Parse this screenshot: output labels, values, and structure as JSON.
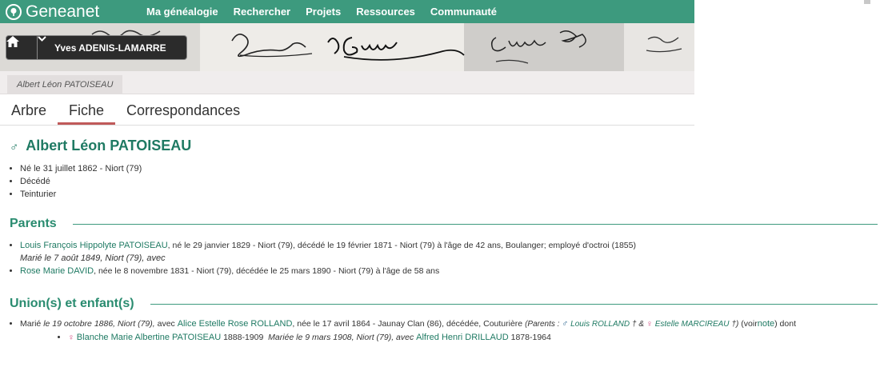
{
  "brand": {
    "name": "Geneanet"
  },
  "nav": {
    "items": [
      "Ma généalogie",
      "Rechercher",
      "Projets",
      "Ressources",
      "Communauté"
    ]
  },
  "tree_owner": "Yves ADENIS-LAMARRE",
  "breadcrumb": "Albert Léon PATOISEAU",
  "tabs": [
    "Arbre",
    "Fiche",
    "Correspondances"
  ],
  "active_tab": "Fiche",
  "person": {
    "name": "Albert Léon PATOISEAU",
    "facts": [
      "Né le 31 juillet 1862 - Niort (79)",
      "Décédé",
      "Teinturier"
    ]
  },
  "parents": {
    "title": "Parents",
    "father_link": "Louis François Hippolyte PATOISEAU",
    "father_details": ", né le 29 janvier 1829 - Niort (79), décédé le 19 février 1871 - Niort (79) à l'âge de 42 ans, Boulanger; employé d'octroi (1855)",
    "marriage": "Marié le 7 août 1849, Niort (79), avec",
    "mother_link": "Rose Marie DAVID",
    "mother_details": ", née le 8 novembre 1831 - Niort (79), décédée le 25 mars 1890 - Niort (79) à l'âge de 58 ans"
  },
  "unions": {
    "title": "Union(s) et enfant(s)",
    "married": "Marié",
    "marriage_date": "le 19 octobre 1886, Niort (79),",
    "with": "avec",
    "spouse_link": "Alice Estelle Rose ROLLAND",
    "spouse_details": ", née le 17 avril 1864 - Jaunay Clan (86), décédée, Couturière",
    "parents_label": "(Parents :",
    "spouse_father": "Louis ROLLAND",
    "dagger_amp": "† &",
    "spouse_mother": "Estelle MARCIREAU",
    "dagger_close": "†)",
    "voir": "(voir",
    "note_link": "note",
    "dont": ") dont",
    "child_link": "Blanche Marie Albertine PATOISEAU",
    "child_years": "1888-1909",
    "child_marriage": "Mariée le 9 mars 1908, Niort (79), avec",
    "child_spouse_link": "Alfred Henri DRILLAUD",
    "child_spouse_years": "1878-1964"
  },
  "colors": {
    "brand_green": "#3d9a7e",
    "link_green": "#1f7a63",
    "tab_accent": "#c05a5a",
    "female": "#d0407a"
  }
}
